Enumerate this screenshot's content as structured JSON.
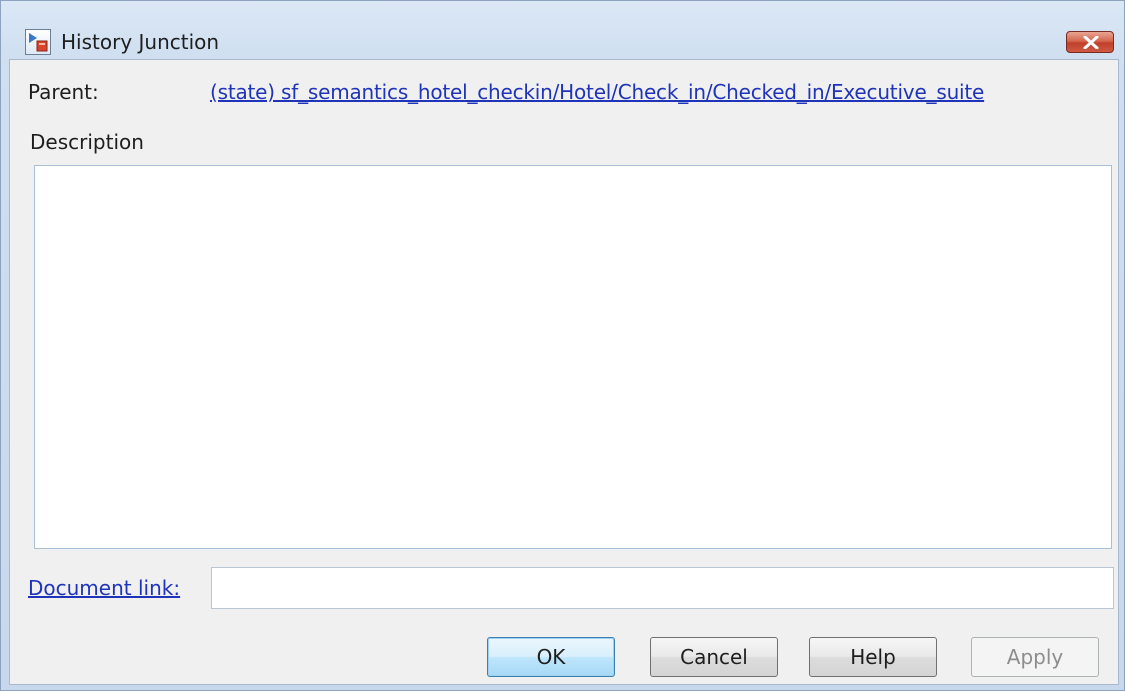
{
  "window": {
    "title": "History Junction",
    "close_icon": "close-icon"
  },
  "parent": {
    "label": "Parent:",
    "link": "(state) sf_semantics_hotel_checkin/Hotel/Check_in/Checked_in/Executive_suite"
  },
  "description": {
    "label": "Description",
    "value": ""
  },
  "document_link": {
    "label": "Document link:",
    "value": ""
  },
  "buttons": {
    "ok": "OK",
    "cancel": "Cancel",
    "help": "Help",
    "apply": "Apply"
  },
  "colors": {
    "link": "#1f34b8",
    "ok_accent": "#3c7fb1",
    "close_red": "#c0402b"
  }
}
